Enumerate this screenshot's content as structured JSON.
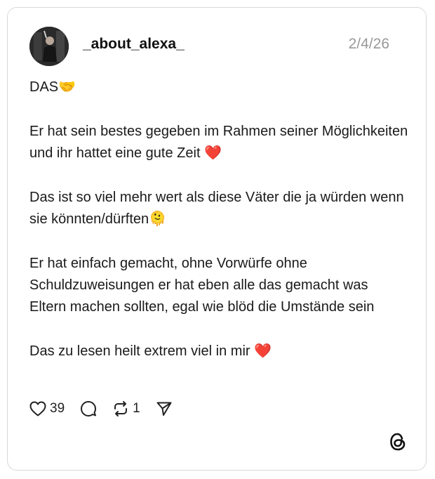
{
  "post": {
    "username": "_about_alexa_",
    "date": "2/4/26",
    "paragraphs": [
      "DAS🤝",
      "Er hat sein bestes gegeben im Rahmen seiner Möglichkeiten und  ihr hattet eine gute Zeit ❤️",
      "Das ist so viel mehr wert als diese Väter die ja würden wenn sie könnten/dürften🫠",
      "Er hat einfach gemacht, ohne Vorwürfe ohne Schuldzuweisungen er hat eben alle das gemacht was Eltern machen sollten, egal wie blöd die Umstände sein",
      "Das zu lesen heilt extrem viel in mir ❤️"
    ]
  },
  "actions": {
    "like_icon": "heart-icon",
    "like_count": "39",
    "comment_icon": "comment-icon",
    "repost_icon": "repost-icon",
    "repost_count": "1",
    "share_icon": "send-icon"
  },
  "brand": {
    "logo_icon": "threads-logo-icon"
  }
}
